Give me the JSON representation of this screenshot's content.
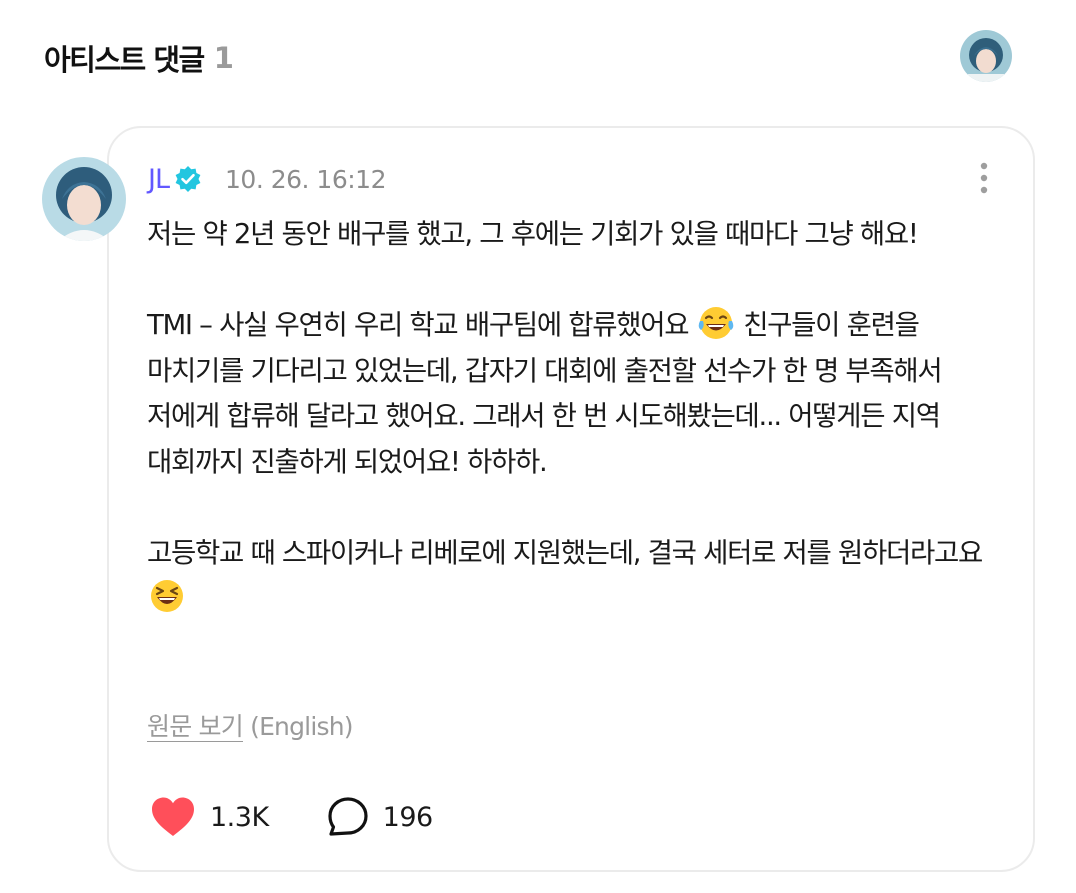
{
  "header": {
    "title": "아티스트 댓글",
    "count": "1",
    "avatar_icon": "user-avatar"
  },
  "comment": {
    "author": "JL",
    "verified_icon": "verified-badge-icon",
    "timestamp": "10. 26. 16:12",
    "more_icon": "more-vertical-icon",
    "body": {
      "p1": "저는 약 2년 동안 배구를 했고, 그 후에는 기회가 있을 때마다 그냥 해요!",
      "p2_a": "TMI – 사실 우연히 우리 학교 배구팀에 합류했어요",
      "p2_emoji": "tears-of-joy-emoji",
      "p2_b": "친구들이 훈련을 마치기를 기다리고 있었는데, 갑자기 대회에 출전할 선수가 한 명 부족해서 저에게 합류해 달라고 했어요. 그래서 한 번 시도해봤는데... 어떻게든 지역 대회까지 진출하게 되었어요! 하하하.",
      "p3": "고등학교 때 스파이커나 리베로에 지원했는데, 결국 세터로 저를 원하더라고요",
      "p3_emoji": "laughing-squint-emoji"
    },
    "translate": {
      "link_label": "원문 보기",
      "language": "(English)"
    },
    "likes": "1.3K",
    "replies": "196",
    "colors": {
      "author": "#6258ff",
      "verified": "#22c6e0",
      "heart": "#ff4f5a"
    }
  }
}
